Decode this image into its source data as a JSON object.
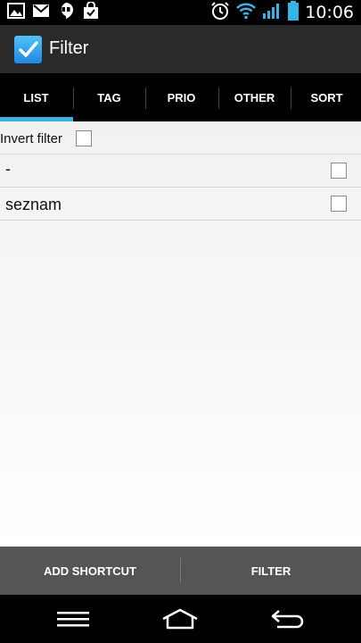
{
  "statusbar": {
    "time": "10:06"
  },
  "app": {
    "title": "Filter",
    "accent": "#33b5e5"
  },
  "tabs": [
    {
      "label": "LIST",
      "selected": true
    },
    {
      "label": "TAG",
      "selected": false
    },
    {
      "label": "PRIO",
      "selected": false
    },
    {
      "label": "OTHER",
      "selected": false
    },
    {
      "label": "SORT",
      "selected": false
    }
  ],
  "invert_filter": {
    "label": "Invert filter",
    "checked": false
  },
  "list_items": [
    {
      "label": "-",
      "checked": false
    },
    {
      "label": "seznam",
      "checked": false
    }
  ],
  "bottom_buttons": {
    "add_shortcut": "ADD SHORTCUT",
    "filter": "FILTER"
  }
}
